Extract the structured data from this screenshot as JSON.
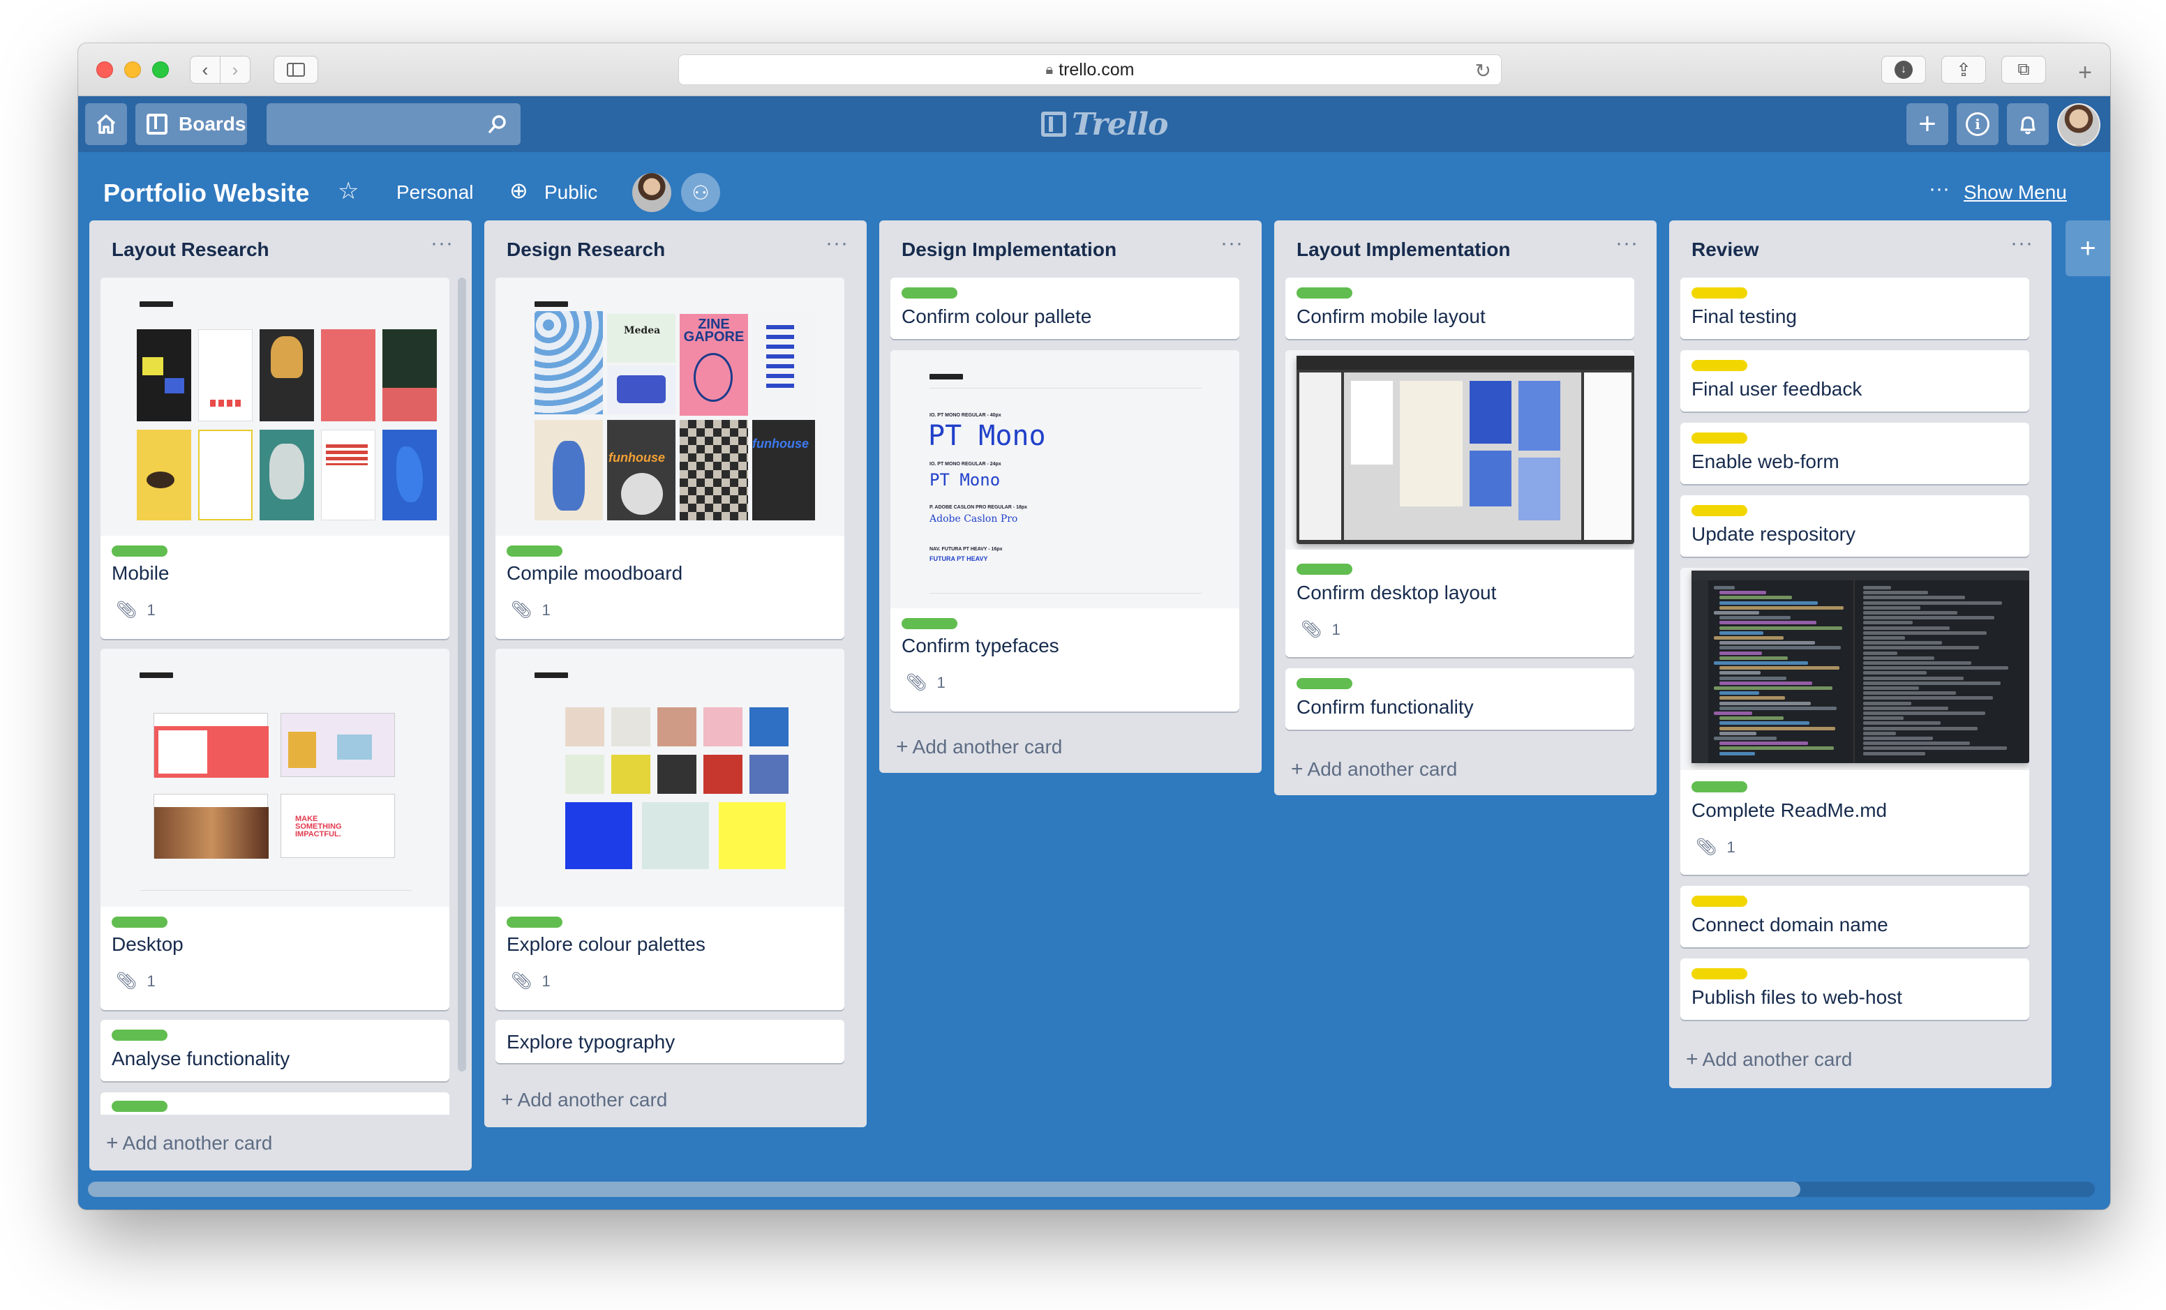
{
  "browser": {
    "url": "trello.com"
  },
  "header": {
    "boards_label": "Boards",
    "logo_text": "Trello"
  },
  "board": {
    "title": "Portfolio Website",
    "visibility_team": "Personal",
    "visibility": "Public",
    "show_menu": "Show Menu",
    "dots": "···"
  },
  "add_card_label": "Add another card",
  "lists": [
    {
      "title": "Layout Research",
      "cards": [
        {
          "title": "Mobile",
          "label": "green",
          "attachments": "1",
          "cover": "INSPIRATION"
        },
        {
          "title": "Desktop",
          "label": "green",
          "attachments": "1",
          "cover": "INSPIRATION"
        },
        {
          "title": "Analyse functionality",
          "label": "green"
        }
      ]
    },
    {
      "title": "Design Research",
      "cards": [
        {
          "title": "Compile moodboard",
          "label": "green",
          "attachments": "1",
          "cover": "MOOD BOARD"
        },
        {
          "title": "Explore colour palettes",
          "label": "green",
          "attachments": "1",
          "cover": "COLOUR PALETTE"
        },
        {
          "title": "Explore typography"
        }
      ]
    },
    {
      "title": "Design Implementation",
      "cards": [
        {
          "title": "Confirm colour pallete",
          "label": "green"
        },
        {
          "title": "Confirm typefaces",
          "label": "green",
          "attachments": "1",
          "cover": "TYPOGRAPHY"
        }
      ]
    },
    {
      "title": "Layout Implementation",
      "cards": [
        {
          "title": "Confirm mobile layout",
          "label": "green"
        },
        {
          "title": "Confirm desktop layout",
          "label": "green",
          "attachments": "1"
        },
        {
          "title": "Confirm functionality",
          "label": "green"
        }
      ]
    },
    {
      "title": "Review",
      "cards": [
        {
          "title": "Final testing",
          "label": "yellow"
        },
        {
          "title": "Final user feedback",
          "label": "yellow"
        },
        {
          "title": "Enable web-form",
          "label": "yellow"
        },
        {
          "title": "Update respository",
          "label": "yellow"
        },
        {
          "title": "Complete ReadMe.md",
          "label": "green",
          "attachments": "1"
        },
        {
          "title": "Connect domain name",
          "label": "yellow"
        },
        {
          "title": "Publish files to web-host",
          "label": "yellow"
        }
      ]
    }
  ],
  "typography_cover": {
    "line1_caption": "IO. PT MONO REGULAR - 40px",
    "line1_sample": "PT Mono",
    "line2_caption": "IO. PT MONO REGULAR - 24px",
    "line2_sample": "PT Mono",
    "line3_caption": "P. ADOBE CASLON PRO REGULAR - 18px",
    "line3_sample": "Adobe Caslon Pro",
    "line4_caption": "NAV. FUTURA PT HEAVY - 16px",
    "line4_sample": "FUTURA PT HEAVY"
  },
  "moodboard_cover": {
    "zine": "ZINE GAPORE",
    "medea": "Medea",
    "funhouse": "funhouse"
  },
  "desktop_cover": {
    "make": "MAKE SOMETHING IMPACTFUL."
  },
  "colors": {
    "board_bg": "#2f79bf",
    "header_bg": "#2a65a4",
    "list_bg": "#dfe1e6",
    "label_green": "#61bd4f",
    "label_yellow": "#f2d600",
    "palette": [
      "#e8d7c8",
      "#e6e4df",
      "#cf9b86",
      "#f1b9c4",
      "#2f6fc4",
      "#e3eddc",
      "#e3d53a",
      "#333333",
      "#c8372d",
      "#5672b8",
      "#1d3de8",
      "#d8e9e5",
      "#fffa4a"
    ]
  }
}
